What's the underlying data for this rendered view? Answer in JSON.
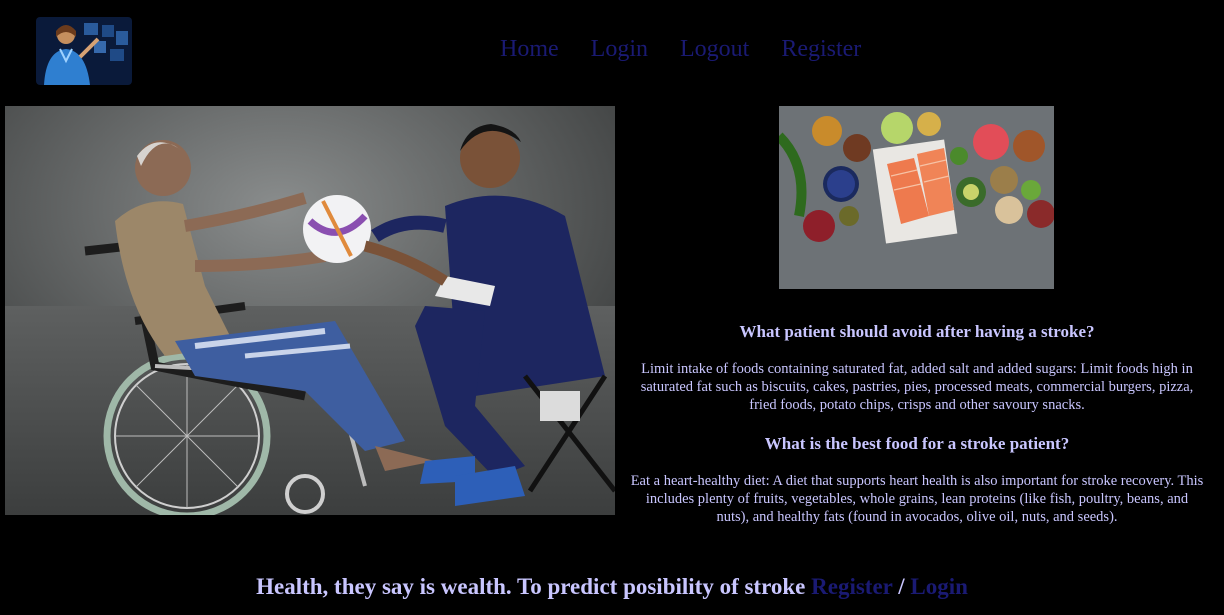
{
  "nav": {
    "home": "Home",
    "login": "Login",
    "logout": "Logout",
    "register": "Register"
  },
  "sections": [
    {
      "heading": "What patient should avoid after having a stroke?",
      "body": "Limit intake of foods containing saturated fat, added salt and added sugars: Limit foods high in saturated fat such as biscuits, cakes, pastries, pies, processed meats, commercial burgers, pizza, fried foods, potato chips, crisps and other savoury snacks."
    },
    {
      "heading": "What is the best food for a stroke patient?",
      "body": "Eat a heart-healthy diet: A diet that supports heart health is also important for stroke recovery. This includes plenty of fruits, vegetables, whole grains, lean proteins (like fish, poultry, beans, and nuts), and healthy fats (found in avocados, olive oil, nuts, and seeds)."
    }
  ],
  "footer": {
    "text": "Health, they say is wealth. To predict posibility of stroke ",
    "register": "Register",
    "separator": " / ",
    "login": "Login"
  },
  "colors": {
    "background": "#000000",
    "text": "#c9c6ff",
    "link": "#1a1a73"
  }
}
